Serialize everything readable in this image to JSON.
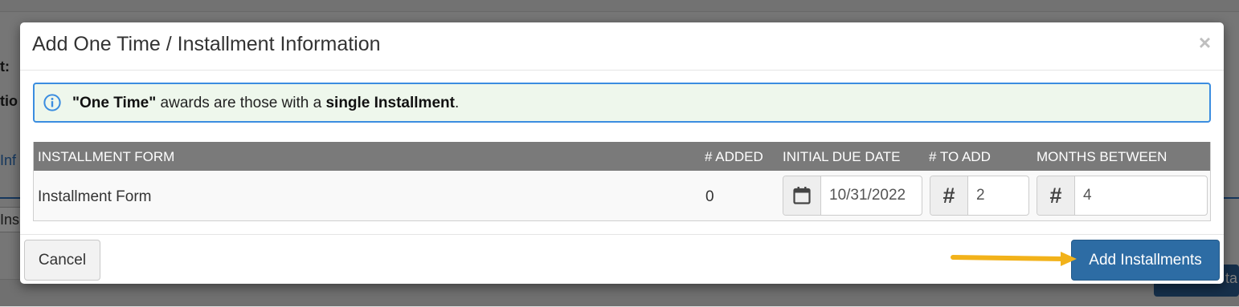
{
  "background": {
    "label_1": "t:",
    "label_2": "tio",
    "link_text": "Inf",
    "tab_text": "Ins",
    "button_fragment": "ta"
  },
  "modal": {
    "title": "Add One Time / Installment Information",
    "close_glyph": "×",
    "info": {
      "icon": "info-circle-icon",
      "quoted_term": "\"One Time\"",
      "middle_text": " awards are those with a ",
      "bold_term": "single Installment",
      "end_text": "."
    },
    "table": {
      "headers": {
        "form": "INSTALLMENT FORM",
        "added": "# ADDED",
        "initial_due_date": "INITIAL DUE DATE",
        "to_add": "# TO ADD",
        "months_between": "MONTHS BETWEEN"
      },
      "rows": [
        {
          "form": "Installment Form",
          "added": "0",
          "initial_due_date": "10/31/2022",
          "to_add": "2",
          "months_between": "4"
        }
      ],
      "addon_icons": {
        "date": "calendar-icon",
        "to_add": "hash-icon",
        "months_between": "hash-icon"
      },
      "hash_glyph": "#"
    },
    "footer": {
      "cancel_label": "Cancel",
      "add_label": "Add Installments"
    }
  },
  "colors": {
    "primary_button": "#2d6ca4",
    "info_border": "#3b8de0",
    "info_background": "#eef7ec",
    "table_header": "#7a7a7a",
    "annotation_arrow": "#f2b21a"
  }
}
